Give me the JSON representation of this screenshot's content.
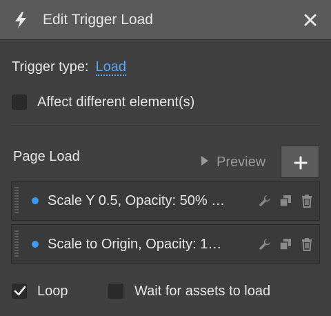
{
  "header": {
    "icon": "lightning-bolt-icon",
    "title": "Edit Trigger Load",
    "close_icon": "close-icon"
  },
  "trigger": {
    "label": "Trigger type:",
    "value": "Load"
  },
  "affect_option": {
    "label": "Affect different element(s)",
    "checked": false
  },
  "section": {
    "title": "Page Load",
    "preview_label": "Preview",
    "add_icon": "plus-icon"
  },
  "actions": [
    {
      "label": "Scale Y 0.5, Opacity: 50% …",
      "icons": [
        "wrench-icon",
        "duplicate-icon",
        "trash-icon"
      ]
    },
    {
      "label": "Scale to Origin, Opacity: 1…",
      "icons": [
        "wrench-icon",
        "duplicate-icon",
        "trash-icon"
      ]
    }
  ],
  "footer": {
    "loop_label": "Loop",
    "loop_checked": true,
    "wait_label": "Wait for assets to load",
    "wait_checked": false
  },
  "colors": {
    "accent": "#5aa5f5",
    "status_dot": "#3d9af0",
    "header_bg": "#5a5a5a",
    "panel_bg": "#404040"
  }
}
